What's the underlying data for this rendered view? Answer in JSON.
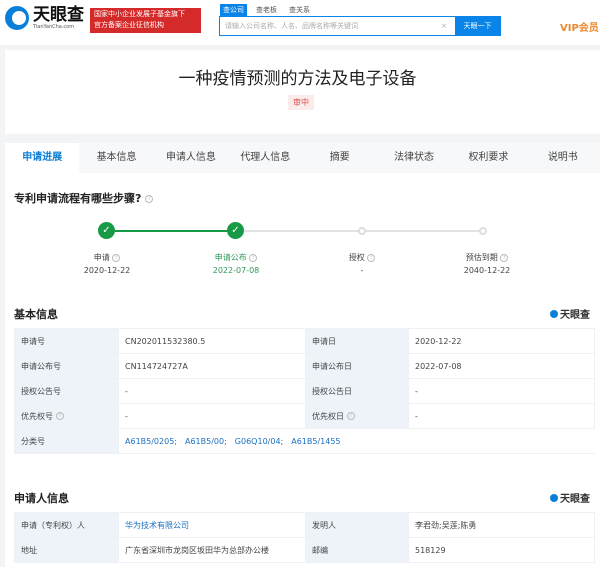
{
  "header": {
    "logo_text": "天眼查",
    "logo_domain": "TianYanCha.com",
    "banner_line1": "国家中小企业发展子基金旗下",
    "banner_line2": "官方备案企业征信机构",
    "search_tabs": [
      "查公司",
      "查老板",
      "查关系"
    ],
    "search_placeholder": "请输入公司名称、人名、品牌名称等关键词",
    "search_button": "天眼一下",
    "vip": "VIP会员"
  },
  "patent": {
    "title": "一种疫情预测的方法及电子设备",
    "status": "审中"
  },
  "tabs": [
    "申请进展",
    "基本信息",
    "申请人信息",
    "代理人信息",
    "摘要",
    "法律状态",
    "权利要求",
    "说明书"
  ],
  "progress": {
    "heading": "专利申请流程有哪些步骤?",
    "steps": [
      {
        "label": "申请",
        "date": "2020-12-22",
        "done": true
      },
      {
        "label": "申请公布",
        "date": "2022-07-08",
        "done": true
      },
      {
        "label": "授权",
        "date": "-",
        "done": false
      },
      {
        "label": "预估到期",
        "date": "2040-12-22",
        "done": false
      }
    ]
  },
  "basic": {
    "heading": "基本信息",
    "watermark": "天眼查",
    "rows": [
      [
        "申请号",
        "CN202011532380.5",
        "申请日",
        "2020-12-22"
      ],
      [
        "申请公布号",
        "CN114724727A",
        "申请公布日",
        "2022-07-08"
      ],
      [
        "授权公告号",
        "-",
        "授权公告日",
        "-"
      ],
      [
        "优先权号",
        "-",
        "优先权日",
        "-"
      ]
    ],
    "class_label": "分类号",
    "classes": [
      "A61B5/0205;",
      "A61B5/00;",
      "G06Q10/04;",
      "A61B5/1455"
    ]
  },
  "applicant": {
    "heading": "申请人信息",
    "watermark": "天眼查",
    "rows": [
      [
        "申请（专利权）人",
        "华为技术有限公司",
        "发明人",
        "李君劲;吴莲;陈勇"
      ],
      [
        "地址",
        "广东省深圳市龙岗区坂田华为总部办公楼",
        "邮编",
        "518129"
      ]
    ]
  },
  "colors": {
    "accent": "#0a84e8",
    "done": "#179a45",
    "banner": "#d42a2a"
  }
}
